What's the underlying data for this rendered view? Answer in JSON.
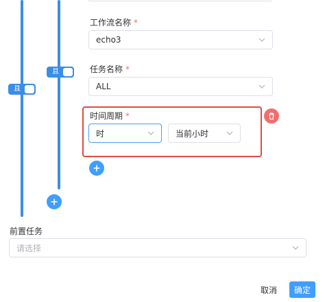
{
  "fields": {
    "workflow_name": {
      "label": "工作流名称",
      "required_mark": "*",
      "value": "echo3"
    },
    "task_name": {
      "label": "任务名称",
      "required_mark": "*",
      "value": "ALL"
    },
    "time_period": {
      "label": "时间周期",
      "required_mark": "*",
      "unit_value": "时",
      "range_value": "当前小时"
    }
  },
  "toggles": {
    "and_label": "且"
  },
  "prerequisite": {
    "label": "前置任务",
    "placeholder": "请选择"
  },
  "footer": {
    "cancel_label": "取消",
    "confirm_label": "确定"
  },
  "colors": {
    "accent": "#409eff",
    "line": "#3a8ee6",
    "danger": "#f56c6c",
    "highlight": "#e04b3f"
  },
  "icons": [
    "chevron-down-icon",
    "trash-icon",
    "plus-icon"
  ]
}
